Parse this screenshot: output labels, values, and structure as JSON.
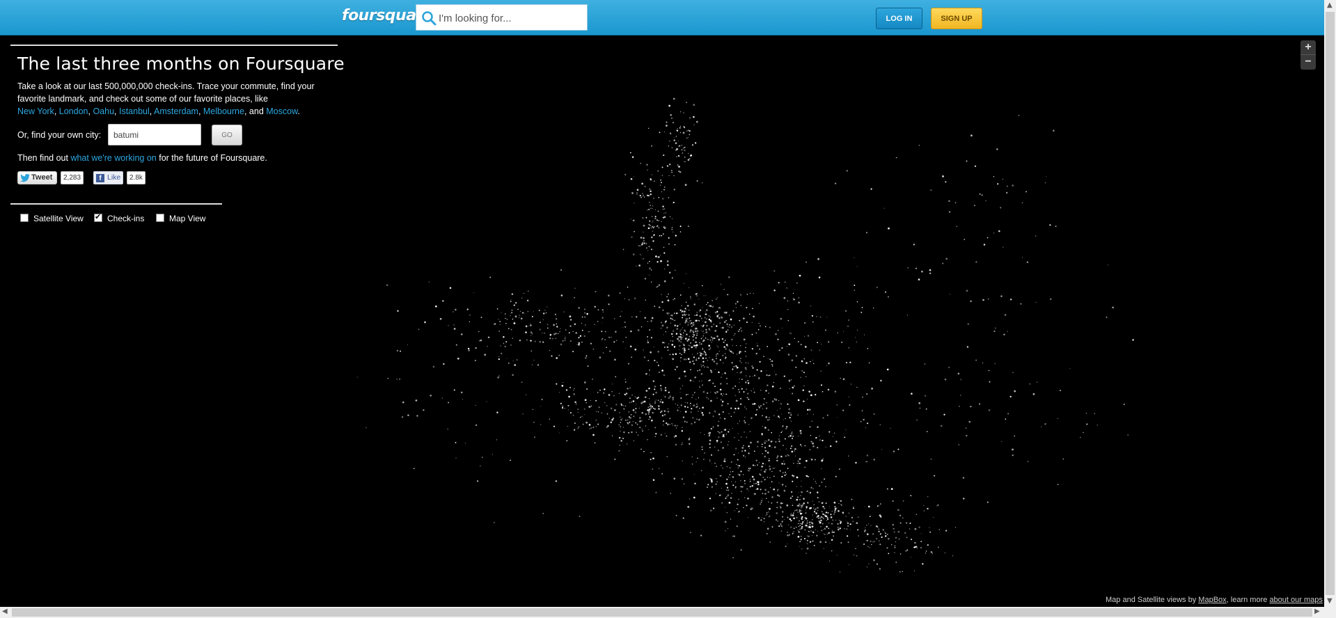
{
  "header": {
    "logo_text": "foursquare",
    "search_placeholder": "I'm looking for...",
    "login_label": "LOG IN",
    "signup_label": "SIGN UP"
  },
  "panel": {
    "title": "The last three months on Foursquare",
    "description": "Take a look at our last 500,000,000 check-ins. Trace your commute, find your favorite landmark, and check out some of our favorite places, like",
    "cities": [
      "New York",
      "London",
      "Oahu",
      "Istanbul",
      "Amsterdam",
      "Melbourne",
      "Moscow"
    ],
    "cities_and": "and",
    "find_label": "Or, find your own city:",
    "city_input_value": "batumi",
    "go_label": "GO",
    "future_prefix": "Then find out",
    "future_link": "what we're working on",
    "future_suffix": "for the future of Foursquare.",
    "tweet_label": "Tweet",
    "tweet_count": "2,283",
    "like_label": "Like",
    "like_count": "2.8k"
  },
  "layers": [
    {
      "label": "Satellite View",
      "checked": false
    },
    {
      "label": "Check-ins",
      "checked": true
    },
    {
      "label": "Map View",
      "checked": false
    }
  ],
  "map": {
    "zoom_in": "+",
    "zoom_out": "−",
    "attribution_prefix": "Map and Satellite views by",
    "attribution_link": "MapBox",
    "attribution_mid": ", learn more",
    "attribution_link2": "about our maps"
  },
  "colors": {
    "header": "#1a97cf",
    "link": "#2ca7e0",
    "signup": "#f0b622",
    "checkin_dot": "#ffffff"
  }
}
